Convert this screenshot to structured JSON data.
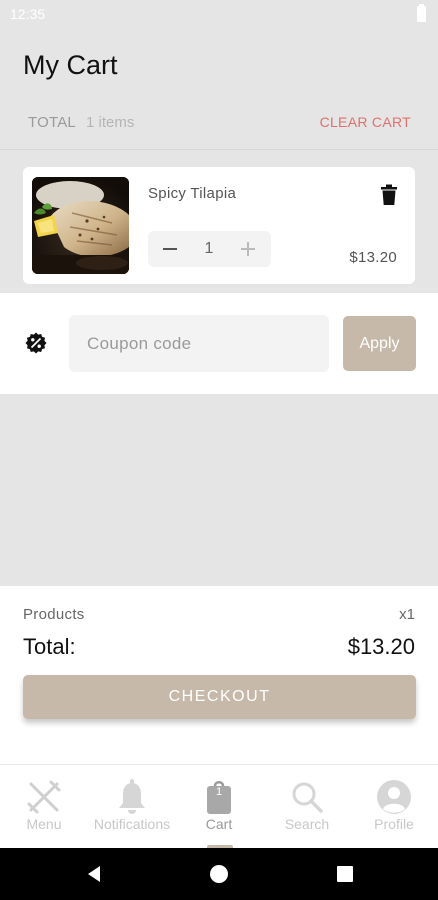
{
  "status_bar": {
    "time": "12:35"
  },
  "header": {
    "title": "My Cart"
  },
  "cart_summary": {
    "total_label": "TOTAL",
    "items_count": "1 items",
    "clear_label": "CLEAR CART"
  },
  "cart_items": [
    {
      "name": "Spicy Tilapia",
      "quantity": "1",
      "price": "$13.20",
      "image_icon": "fish-dish-photo"
    }
  ],
  "coupon": {
    "icon": "discount-badge-icon",
    "placeholder": "Coupon code",
    "value": "",
    "apply_label": "Apply"
  },
  "summary": {
    "products_label": "Products",
    "products_count": "x1",
    "total_label": "Total:",
    "total_amount": "$13.20",
    "checkout_label": "CHECKOUT"
  },
  "bottom_nav": {
    "active": "Cart",
    "items": [
      {
        "label": "Menu",
        "icon": "fork-knife-icon"
      },
      {
        "label": "Notifications",
        "icon": "bell-icon"
      },
      {
        "label": "Cart",
        "icon": "shopping-bag-icon",
        "badge": "1"
      },
      {
        "label": "Search",
        "icon": "search-icon"
      },
      {
        "label": "Profile",
        "icon": "profile-icon"
      }
    ]
  },
  "colors": {
    "accent": "#c7b9aa",
    "danger": "#e0706e",
    "background": "#e5e5e5"
  }
}
